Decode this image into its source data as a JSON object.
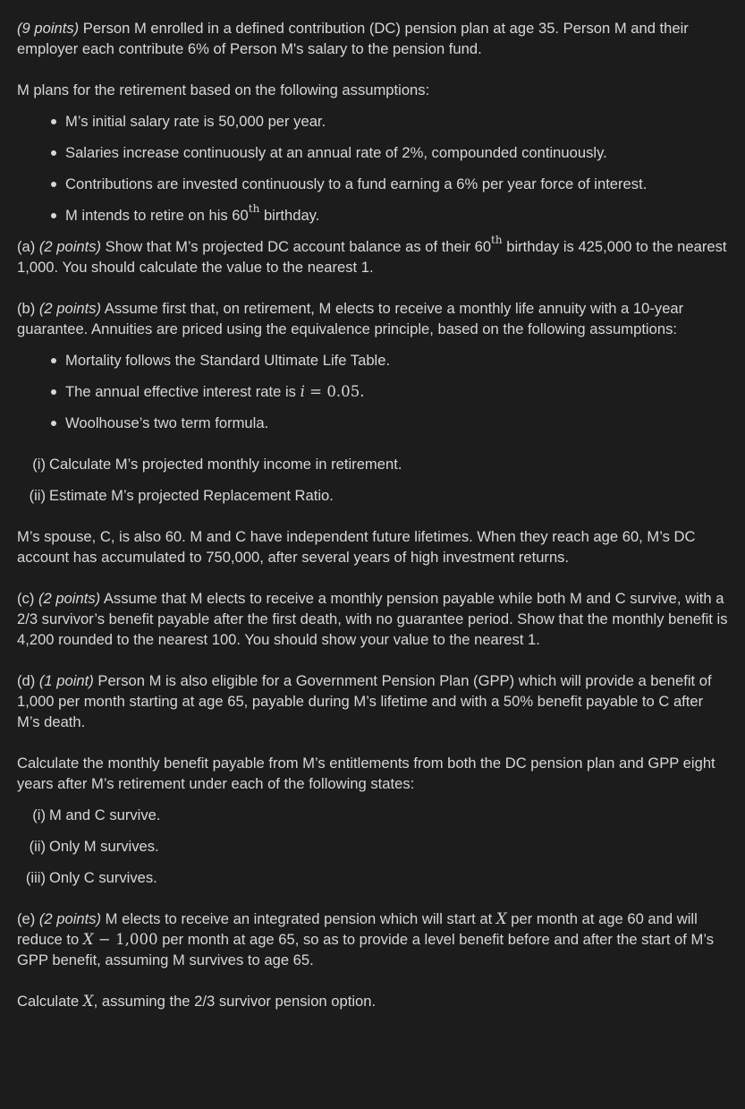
{
  "intro": {
    "points": "(9 points)",
    "text": " Person M enrolled in a defined contribution (DC) pension plan at age 35. Person M and their employer each contribute 6% of Person M's salary to the pension fund."
  },
  "plans_lead": "M plans for the retirement based on the following assumptions:",
  "assumptions": [
    "M’s initial salary rate is 50,000 per year.",
    "Salaries increase continuously at an annual rate of 2%, compounded continuously.",
    "Contributions are invested continuously to a fund earning a 6% per year force of interest."
  ],
  "assumption_retire": {
    "before": "M intends to retire on his 60",
    "sup": "th",
    "after": " birthday."
  },
  "part_a": {
    "label": "(a) ",
    "points": "(2 points)",
    "before": " Show that M’s projected DC account balance as of their 60",
    "sup": "th",
    "after": " birthday is 425,000 to the nearest 1,000. You should calculate the value to the nearest 1."
  },
  "part_b": {
    "label": "(b) ",
    "points": "(2 points)",
    "text": " Assume first that, on retirement, M elects to receive a monthly life annuity with a 10-year guarantee. Annuities are priced using the equivalence principle, based on the following assumptions:",
    "assumption_1": "Mortality follows the Standard Ultimate Life Table.",
    "assumption_2_text": "The annual effective interest rate is ",
    "assumption_2_var": "i",
    "assumption_2_eq": " = 0.05.",
    "assumption_3": "Woolhouse’s two term formula.",
    "subparts": [
      {
        "num": "(i)",
        "text": "Calculate M’s projected monthly income in retirement."
      },
      {
        "num": "(ii)",
        "text": "Estimate M’s projected Replacement Ratio."
      }
    ]
  },
  "spouse": "M’s spouse, C, is also 60. M and C have independent future lifetimes. When they reach age 60, M’s DC account has accumulated to 750,000, after several years of high investment returns.",
  "part_c": {
    "label": "(c) ",
    "points": "(2 points)",
    "text": " Assume that M elects to receive a monthly pension payable while both M and C survive, with a 2/3 survivor’s benefit payable after the first death, with no guarantee period. Show that the monthly benefit is 4,200 rounded to the nearest 100. You should show your value to the nearest 1."
  },
  "part_d": {
    "label": "(d) ",
    "points": "(1 point)",
    "text": " Person M is also eligible for a Government Pension Plan (GPP) which will provide a benefit of 1,000 per month starting at age 65, payable during M’s lifetime and with a 50% benefit payable to C after M’s death.",
    "calc": "Calculate the monthly benefit payable from M’s entitlements from both the DC pension plan and GPP eight years after M’s retirement under each of the following states:",
    "subparts": [
      {
        "num": "(i)",
        "text": "M and C survive."
      },
      {
        "num": "(ii)",
        "text": "Only M survives."
      },
      {
        "num": "(iii)",
        "text": "Only C survives."
      }
    ]
  },
  "part_e": {
    "label": "(e) ",
    "points": "(2 points)",
    "t1": " M elects to receive an integrated pension which will start at ",
    "var1": "X",
    "t2": " per month at age 60 and will reduce to ",
    "var2": "X",
    "eq": " − 1,000",
    "t3": " per month at age 65, so as to provide a level benefit before and after the start of M’s GPP benefit, assuming M survives to age 65.",
    "calc_before": "Calculate ",
    "calc_var": "X",
    "calc_after": ", assuming the 2/3 survivor pension option."
  }
}
